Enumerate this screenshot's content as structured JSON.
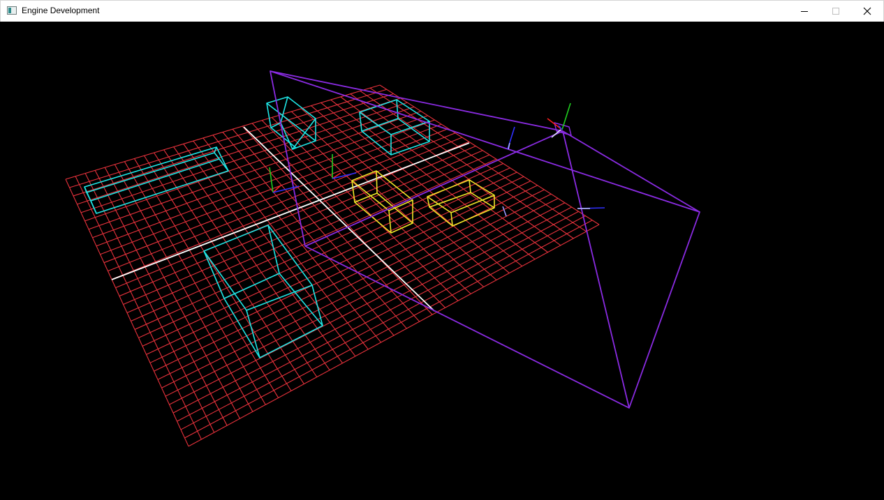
{
  "window": {
    "title": "Engine Development",
    "controls": [
      "minimize",
      "maximize",
      "close"
    ]
  },
  "icons": {
    "app": "app-window-icon",
    "minimize": "minimize-icon",
    "maximize": "maximize-icon",
    "close": "close-icon"
  },
  "scene": {
    "background": "#000000",
    "colors": {
      "grid": "#e8323c",
      "axis": "#ffffff",
      "obstacle": "#1ee6e6",
      "selected": "#f0e628",
      "frustum": "#8a2be2",
      "gizmo_x": "#ff2020",
      "gizmo_y": "#20d020",
      "gizmo_z": "#3030ff"
    },
    "objects": [
      {
        "kind": "grid-plane",
        "divisions": 32
      },
      {
        "kind": "wire-box",
        "role": "obstacle",
        "count": 4
      },
      {
        "kind": "wire-box",
        "role": "selected",
        "count": 2
      },
      {
        "kind": "camera-frustum"
      },
      {
        "kind": "axis-gizmo",
        "count": 5
      }
    ]
  }
}
